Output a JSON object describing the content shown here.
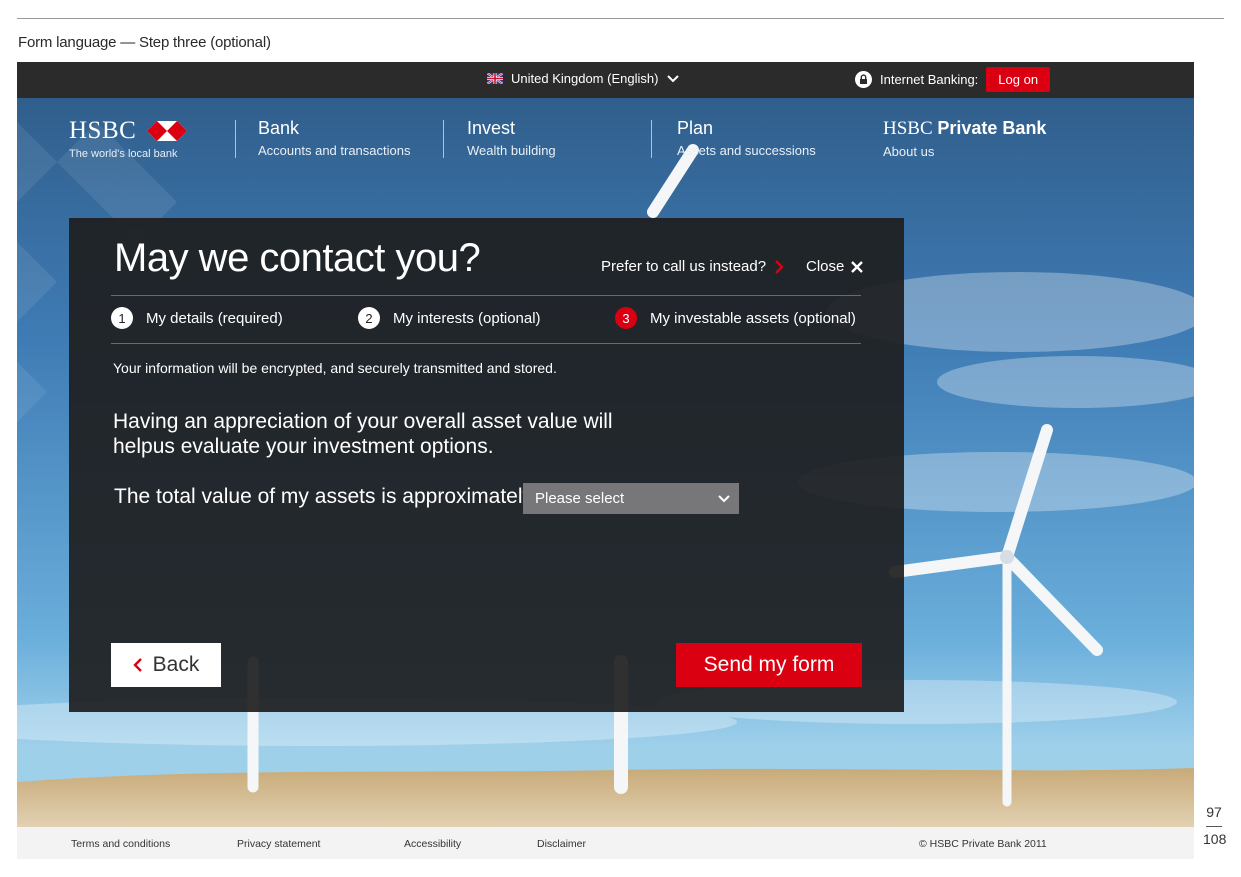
{
  "document": {
    "caption": "Form language — Step three (optional)",
    "page_current": "97",
    "page_total": "108"
  },
  "topbar": {
    "locale_label": "United Kingdom (English)",
    "internet_banking_label": "Internet Banking:",
    "logon_label": "Log on"
  },
  "brand": {
    "logo_text": "HSBC",
    "tagline": "The world's local bank",
    "accent_color": "#db0011"
  },
  "nav": {
    "items": [
      {
        "title": "Bank",
        "sub": "Accounts and transactions"
      },
      {
        "title": "Invest",
        "sub": "Wealth building"
      },
      {
        "title": "Plan",
        "sub": "Assets and successions"
      }
    ],
    "private_bank": {
      "title_main": "HSBC",
      "title_bold": "Private Bank",
      "sub": "About us"
    }
  },
  "form": {
    "title": "May we contact you?",
    "call_link": "Prefer to call us instead?",
    "close_label": "Close",
    "steps": [
      {
        "num": "1",
        "label": "My details (required)"
      },
      {
        "num": "2",
        "label": "My interests (optional)"
      },
      {
        "num": "3",
        "label": "My investable assets (optional)"
      }
    ],
    "secure_note": "Your information will be encrypted, and securely transmitted and stored.",
    "lead": "Having an appreciation of your overall asset value will helpus evaluate your investment options.",
    "assets_label": "The total value of my assets is approximately",
    "select_value": "Please select",
    "back_label": "Back",
    "send_label": "Send my form"
  },
  "footer": {
    "links": [
      "Terms and conditions",
      "Privacy statement",
      "Accessibility",
      "Disclaimer"
    ],
    "copyright": "© HSBC Private Bank 2011"
  }
}
